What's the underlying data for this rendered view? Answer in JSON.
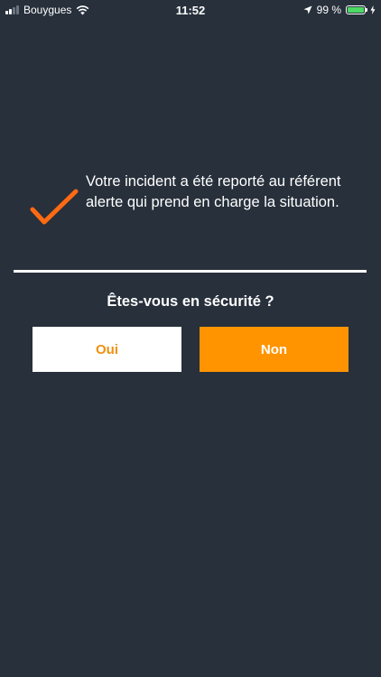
{
  "status_bar": {
    "carrier": "Bouygues",
    "time": "11:52",
    "battery_percent": "99 %",
    "battery_level": 0.99,
    "battery_color": "#4cd964"
  },
  "confirmation": {
    "icon": "check-icon",
    "icon_color": "#ff6a13",
    "message": "Votre incident a été reporté au référent alerte qui prend en charge la situation."
  },
  "question": "Êtes-vous en sécurité ?",
  "buttons": {
    "yes_label": "Oui",
    "no_label": "Non"
  },
  "colors": {
    "background": "#27303b",
    "accent": "#ff9400"
  }
}
